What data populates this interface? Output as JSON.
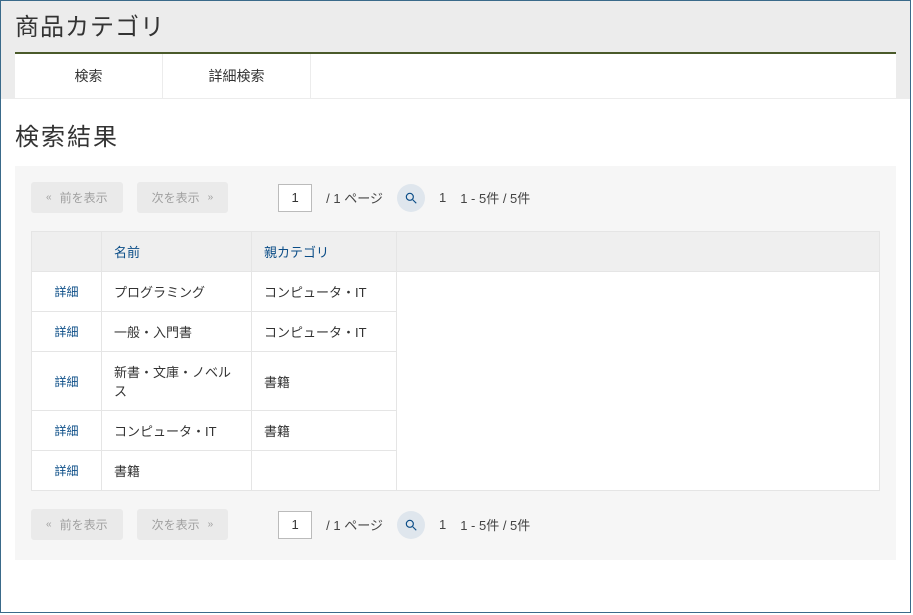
{
  "page": {
    "title": "商品カテゴリ"
  },
  "tabs": {
    "search": "検索",
    "advanced": "詳細検索"
  },
  "results": {
    "heading": "検索結果",
    "pager": {
      "prev_label": "前を表示",
      "next_label": "次を表示",
      "page_value": "1",
      "total_pages_text": "/  1 ページ",
      "current_page_display": "1",
      "count_text": "1 - 5件 / 5件"
    },
    "columns": {
      "action": "",
      "name": "名前",
      "parent": "親カテゴリ"
    },
    "detail_label": "詳細",
    "rows": [
      {
        "name": "プログラミング",
        "parent": "コンピュータ・IT"
      },
      {
        "name": "一般・入門書",
        "parent": "コンピュータ・IT"
      },
      {
        "name": "新書・文庫・ノベルス",
        "parent": "書籍"
      },
      {
        "name": "コンピュータ・IT",
        "parent": "書籍"
      },
      {
        "name": "書籍",
        "parent": ""
      }
    ]
  }
}
